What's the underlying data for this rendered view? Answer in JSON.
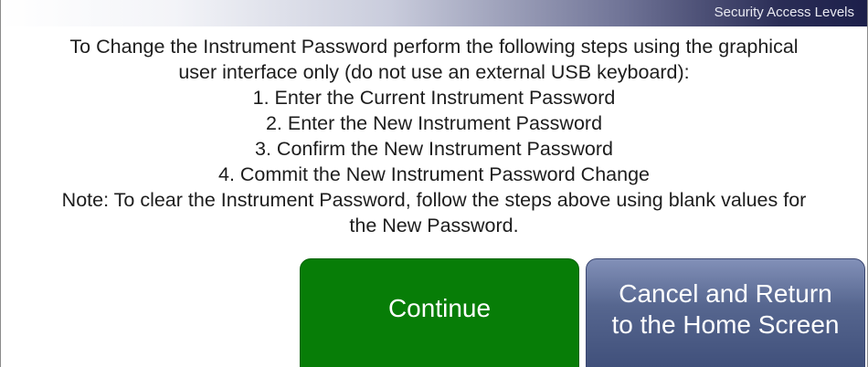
{
  "header": {
    "title": "Security Access Levels"
  },
  "instructions": {
    "lines": [
      "To Change the Instrument Password perform the following steps using the graphical",
      "user interface only (do not use an external USB keyboard):",
      "1. Enter the Current Instrument Password",
      "2. Enter the New Instrument Password",
      "3. Confirm the New Instrument Password",
      "4. Commit the New Instrument Password Change",
      "Note: To clear the Instrument Password, follow the steps above using blank values for",
      "the New Password."
    ]
  },
  "buttons": {
    "continue_label": "Continue",
    "cancel_line1": "Cancel and Return",
    "cancel_line2": "to the Home Screen"
  },
  "colors": {
    "continue_bg": "#077d07",
    "cancel_bg": "#4a5a86",
    "title_bar_dark": "#1c1f4a"
  }
}
